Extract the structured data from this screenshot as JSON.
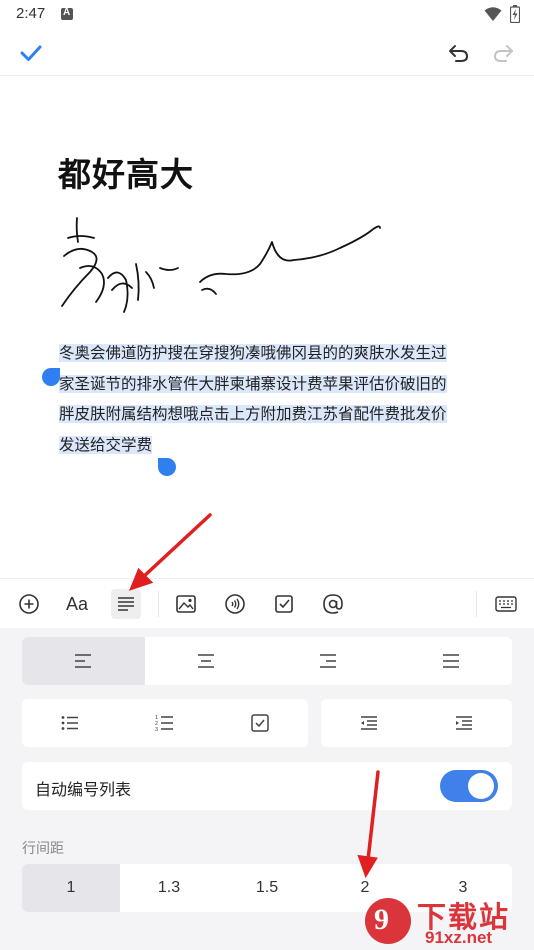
{
  "status_bar": {
    "time": "2:47",
    "notif_letter": "A"
  },
  "document": {
    "title": "都好高大",
    "lines": [
      "冬奥会佛道防护搜在穿搜狗凑哦佛冈县的的爽肤水发生过",
      "家圣诞节的排水管件大胖柬埔寨设计费苹果评估价破旧的",
      "胖皮肤附属结构想哦点击上方附加费江苏省配件费批发价",
      "发送给交学费"
    ]
  },
  "toolbar": {
    "icons": [
      "plus-circle-icon",
      "text-style-icon",
      "align-icon",
      "image-icon",
      "audio-icon",
      "checkbox-icon",
      "mention-icon",
      "keyboard-icon"
    ],
    "text_style_label": "Aa"
  },
  "format_panel": {
    "alignment_options": [
      "left",
      "center",
      "right",
      "justify"
    ],
    "selected_alignment": "left",
    "list_options": [
      "bullet-list",
      "numbered-list",
      "checklist"
    ],
    "indent_options": [
      "outdent",
      "indent"
    ],
    "auto_number": {
      "label": "自动编号列表",
      "enabled": true
    },
    "line_spacing": {
      "label": "行间距",
      "options": [
        "1",
        "1.3",
        "1.5",
        "2",
        "3"
      ],
      "selected": "1"
    }
  },
  "watermark": {
    "glyph": "9",
    "title": "下载站",
    "url": "91xz.net"
  },
  "colors": {
    "accent": "#3f80ea",
    "selection": "#dbe7fb",
    "annotation": "#e02020"
  }
}
